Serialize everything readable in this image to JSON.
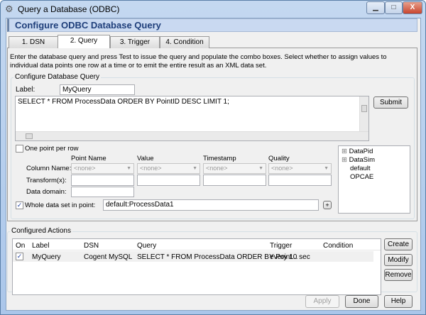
{
  "window": {
    "title": "Query a Database (ODBC)",
    "minimize": "▁",
    "maximize": "□",
    "close": "X"
  },
  "header": {
    "title": "Configure ODBC Database Query"
  },
  "tabs": [
    {
      "label": "1. DSN"
    },
    {
      "label": "2. Query"
    },
    {
      "label": "3. Trigger"
    },
    {
      "label": "4. Condition"
    }
  ],
  "instructions": "Enter the database query and press Test to issue the query and populate the combo boxes.  Select whether to assign values to individual data points one row at a time or to emit the entire result as an XML data set.",
  "query_group": {
    "title": "Configure Database Query",
    "label_caption": "Label:",
    "label_value": "MyQuery",
    "query_text": "SELECT * FROM ProcessData ORDER BY PointID DESC LIMIT 1;",
    "submit": "Submit",
    "one_point_per_row": {
      "label": "One point per row",
      "checked": false
    },
    "columns": [
      "Point Name",
      "Value",
      "Timestamp",
      "Quality"
    ],
    "row_labels": {
      "column_name": "Column Name:",
      "transform": "Transform(x):",
      "data_domain": "Data domain:"
    },
    "combo_value": "<none>",
    "whole_data_set": {
      "label": "Whole data set in point:",
      "checked": true,
      "value": "default:ProcessData1",
      "plus": "+"
    },
    "tree": [
      {
        "label": "DataPid",
        "expander": "⊞"
      },
      {
        "label": "DataSim",
        "expander": "⊞"
      },
      {
        "label": "default"
      },
      {
        "label": "OPCAE"
      }
    ]
  },
  "actions": {
    "title": "Configured Actions",
    "headers": [
      "On",
      "Label",
      "DSN",
      "Query",
      "Trigger",
      "Condition"
    ],
    "rows": [
      {
        "on": "✓",
        "label": "MyQuery",
        "dsn": "Cogent MySQL",
        "query": "SELECT * FROM ProcessData ORDER BY Point...",
        "trigger": "every 10 sec",
        "condition": ""
      }
    ],
    "buttons": {
      "create": "Create",
      "modify": "Modify",
      "remove": "Remove"
    }
  },
  "footer": {
    "apply": "Apply",
    "done": "Done",
    "help": "Help"
  }
}
